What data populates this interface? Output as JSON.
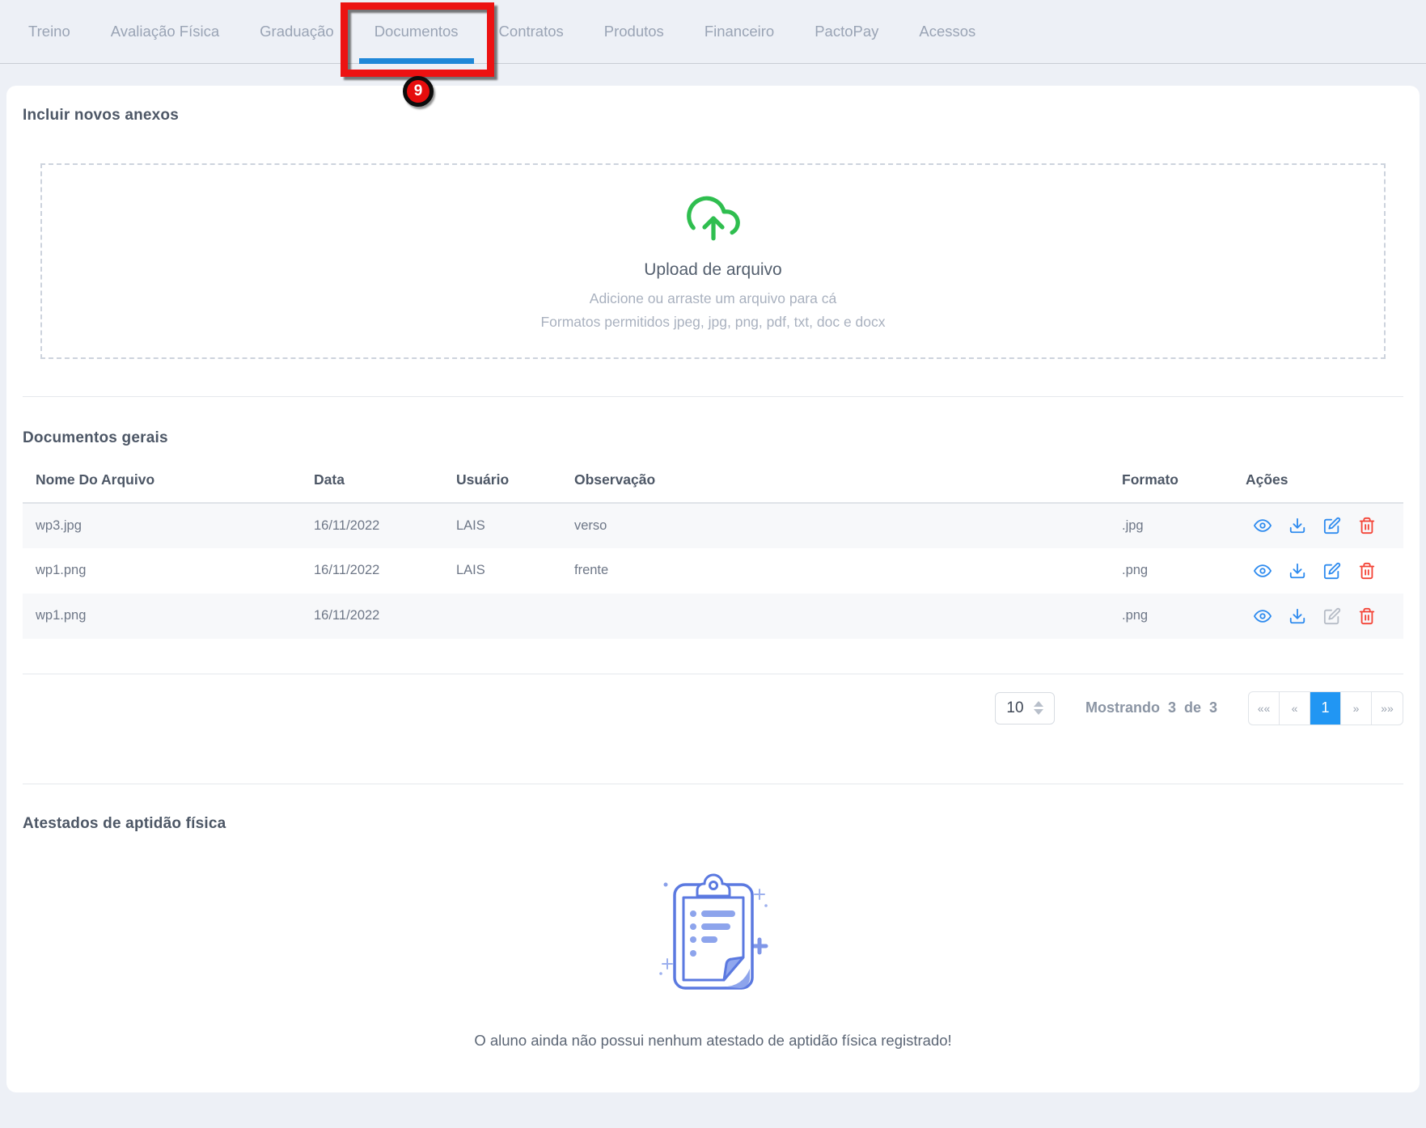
{
  "tabs": {
    "items": [
      {
        "label": "Treino"
      },
      {
        "label": "Avaliação Física"
      },
      {
        "label": "Graduação"
      },
      {
        "label": "Documentos"
      },
      {
        "label": "Contratos"
      },
      {
        "label": "Produtos"
      },
      {
        "label": "Financeiro"
      },
      {
        "label": "PactoPay"
      },
      {
        "label": "Acessos"
      }
    ],
    "active": "Documentos",
    "annotation_badge": "9"
  },
  "sections": {
    "attachments": {
      "title": "Incluir novos anexos",
      "upload_title": "Upload de arquivo",
      "upload_hint": "Adicione ou arraste um arquivo para cá",
      "upload_formats": "Formatos permitidos jpeg, jpg, png, pdf, txt, doc e docx"
    },
    "documents": {
      "title": "Documentos gerais",
      "columns": [
        "Nome Do Arquivo",
        "Data",
        "Usuário",
        "Observação",
        "Formato",
        "Ações"
      ],
      "rows": [
        {
          "name": "wp3.jpg",
          "date": "16/11/2022",
          "user": "LAIS",
          "note": "verso",
          "format": ".jpg"
        },
        {
          "name": "wp1.png",
          "date": "16/11/2022",
          "user": "LAIS",
          "note": "frente",
          "format": ".png"
        },
        {
          "name": "wp1.png",
          "date": "16/11/2022",
          "user": "",
          "note": "",
          "format": ".png"
        }
      ],
      "pagination": {
        "page_size": "10",
        "showing_text": "Mostrando 3 de 3",
        "first_label": "««",
        "prev_label": "«",
        "page_label": "1",
        "next_label": "»",
        "last_label": "»»"
      }
    },
    "certificates": {
      "title": "Atestados de aptidão física",
      "empty_message": "O aluno ainda não possui nenhum atestado de aptidão física registrado!"
    }
  },
  "icons": {
    "upload": "upload-cloud",
    "view": "eye",
    "download": "download-tray",
    "edit": "pencil-square",
    "delete": "trash",
    "page_size": "up-down-stepper",
    "empty_state": "clipboard-checklist"
  },
  "colors": {
    "page_background": "#edf0f6",
    "card_background": "#ffffff",
    "tab_text": "#9aa4b5",
    "active_tab_underline": "#1f87d8",
    "active_page_background": "#2196f3",
    "annotation_red": "#ec1212",
    "upload_icon_green": "#2fbe4f",
    "action_icon_blue": "#2e8bef",
    "action_icon_red": "#f44336",
    "action_icon_disabled": "#b6bcc6",
    "illustration_blue": "#5b79e0"
  }
}
